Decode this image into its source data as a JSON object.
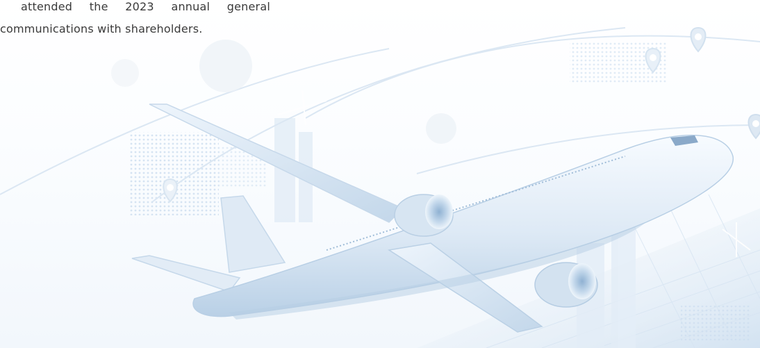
{
  "document": {
    "paragraph_lines": [
      "attended the 2023 annual general",
      "communications with shareholders."
    ]
  },
  "background": {
    "theme_color": "#cfe0f0",
    "accent_color": "#a9c6e2",
    "icons": [
      "airplane-image",
      "location-pin-icon",
      "location-pin-icon",
      "location-pin-icon",
      "location-pin-icon"
    ]
  }
}
